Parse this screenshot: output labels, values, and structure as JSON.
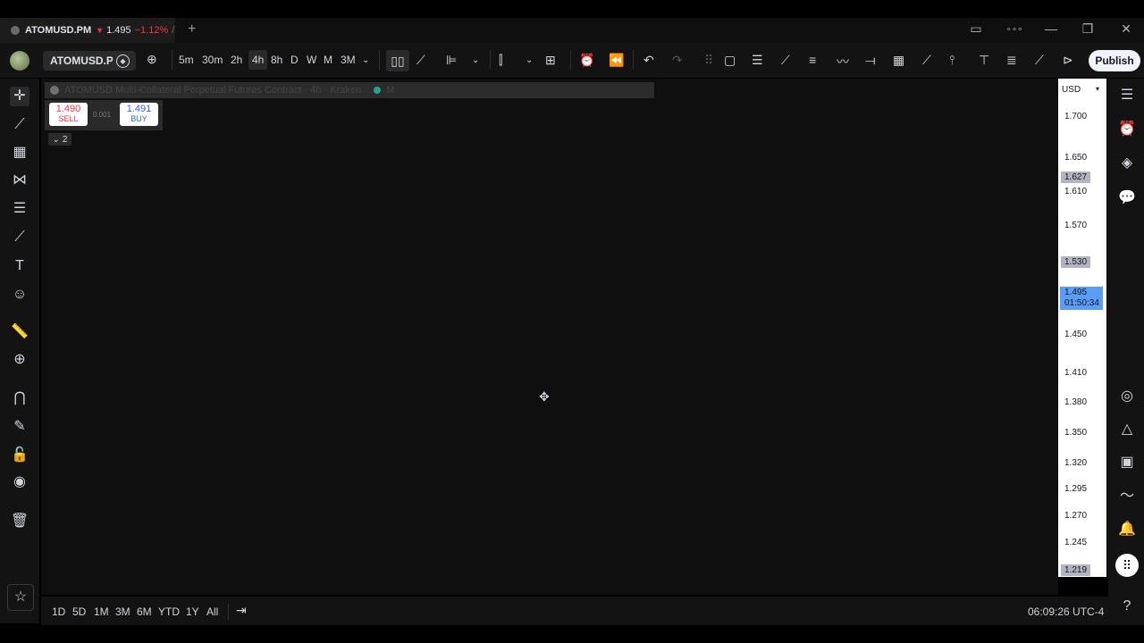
{
  "tab": {
    "symbol": "ATOMUSD.PM",
    "arrow": "▼",
    "price": "1.495",
    "change": "−1.12%",
    "slash": "/"
  },
  "window_controls": {
    "new_tab": "+",
    "layout": "▭",
    "more": "∘∘∘",
    "minimize": "—",
    "restore": "❐",
    "close": "✕"
  },
  "toolbar": {
    "symbol": "ATOMUSD.PM",
    "timeframes": [
      "5m",
      "30m",
      "2h",
      "4h",
      "8h",
      "D",
      "W",
      "M",
      "3M"
    ],
    "active_timeframe": "4h",
    "publish_label": "Publish"
  },
  "legend": {
    "title": "ATOMUSD Multi-Collateral Perpetual Futures Contract · 4h · Kraken",
    "status": "M"
  },
  "trade": {
    "sell_price": "1.490",
    "sell_label": "SELL",
    "buy_price": "1.491",
    "buy_label": "BUY",
    "spread": "0.001",
    "collapse_count": "2"
  },
  "price_scale": {
    "currency": "USD",
    "labels": [
      "1.700",
      "1.650",
      "1.610",
      "1.570",
      "1.450",
      "1.410",
      "1.380",
      "1.350",
      "1.320",
      "1.295",
      "1.270",
      "1.245"
    ],
    "tags": [
      "1.627",
      "1.530",
      "1.219"
    ],
    "last_price": "1.495",
    "countdown": "01:50:34"
  },
  "bottom": {
    "ranges": [
      "1D",
      "5D",
      "1M",
      "3M",
      "6M",
      "YTD",
      "1Y",
      "All"
    ],
    "clock": "06:09:26 UTC-4"
  }
}
